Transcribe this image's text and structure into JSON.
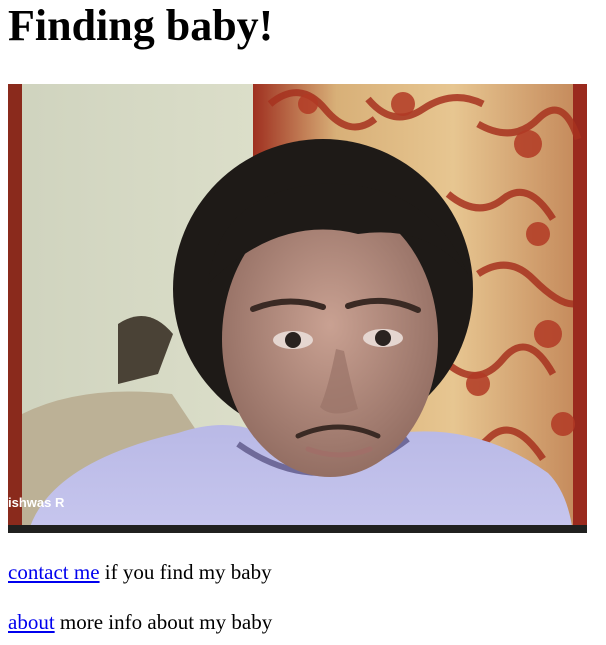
{
  "page": {
    "title": "Finding baby!"
  },
  "photo": {
    "name_tag": "ishwas R"
  },
  "lines": [
    {
      "link": "contact me",
      "text": " if you find my baby"
    },
    {
      "link": "about",
      "text": " more info about my baby"
    }
  ]
}
